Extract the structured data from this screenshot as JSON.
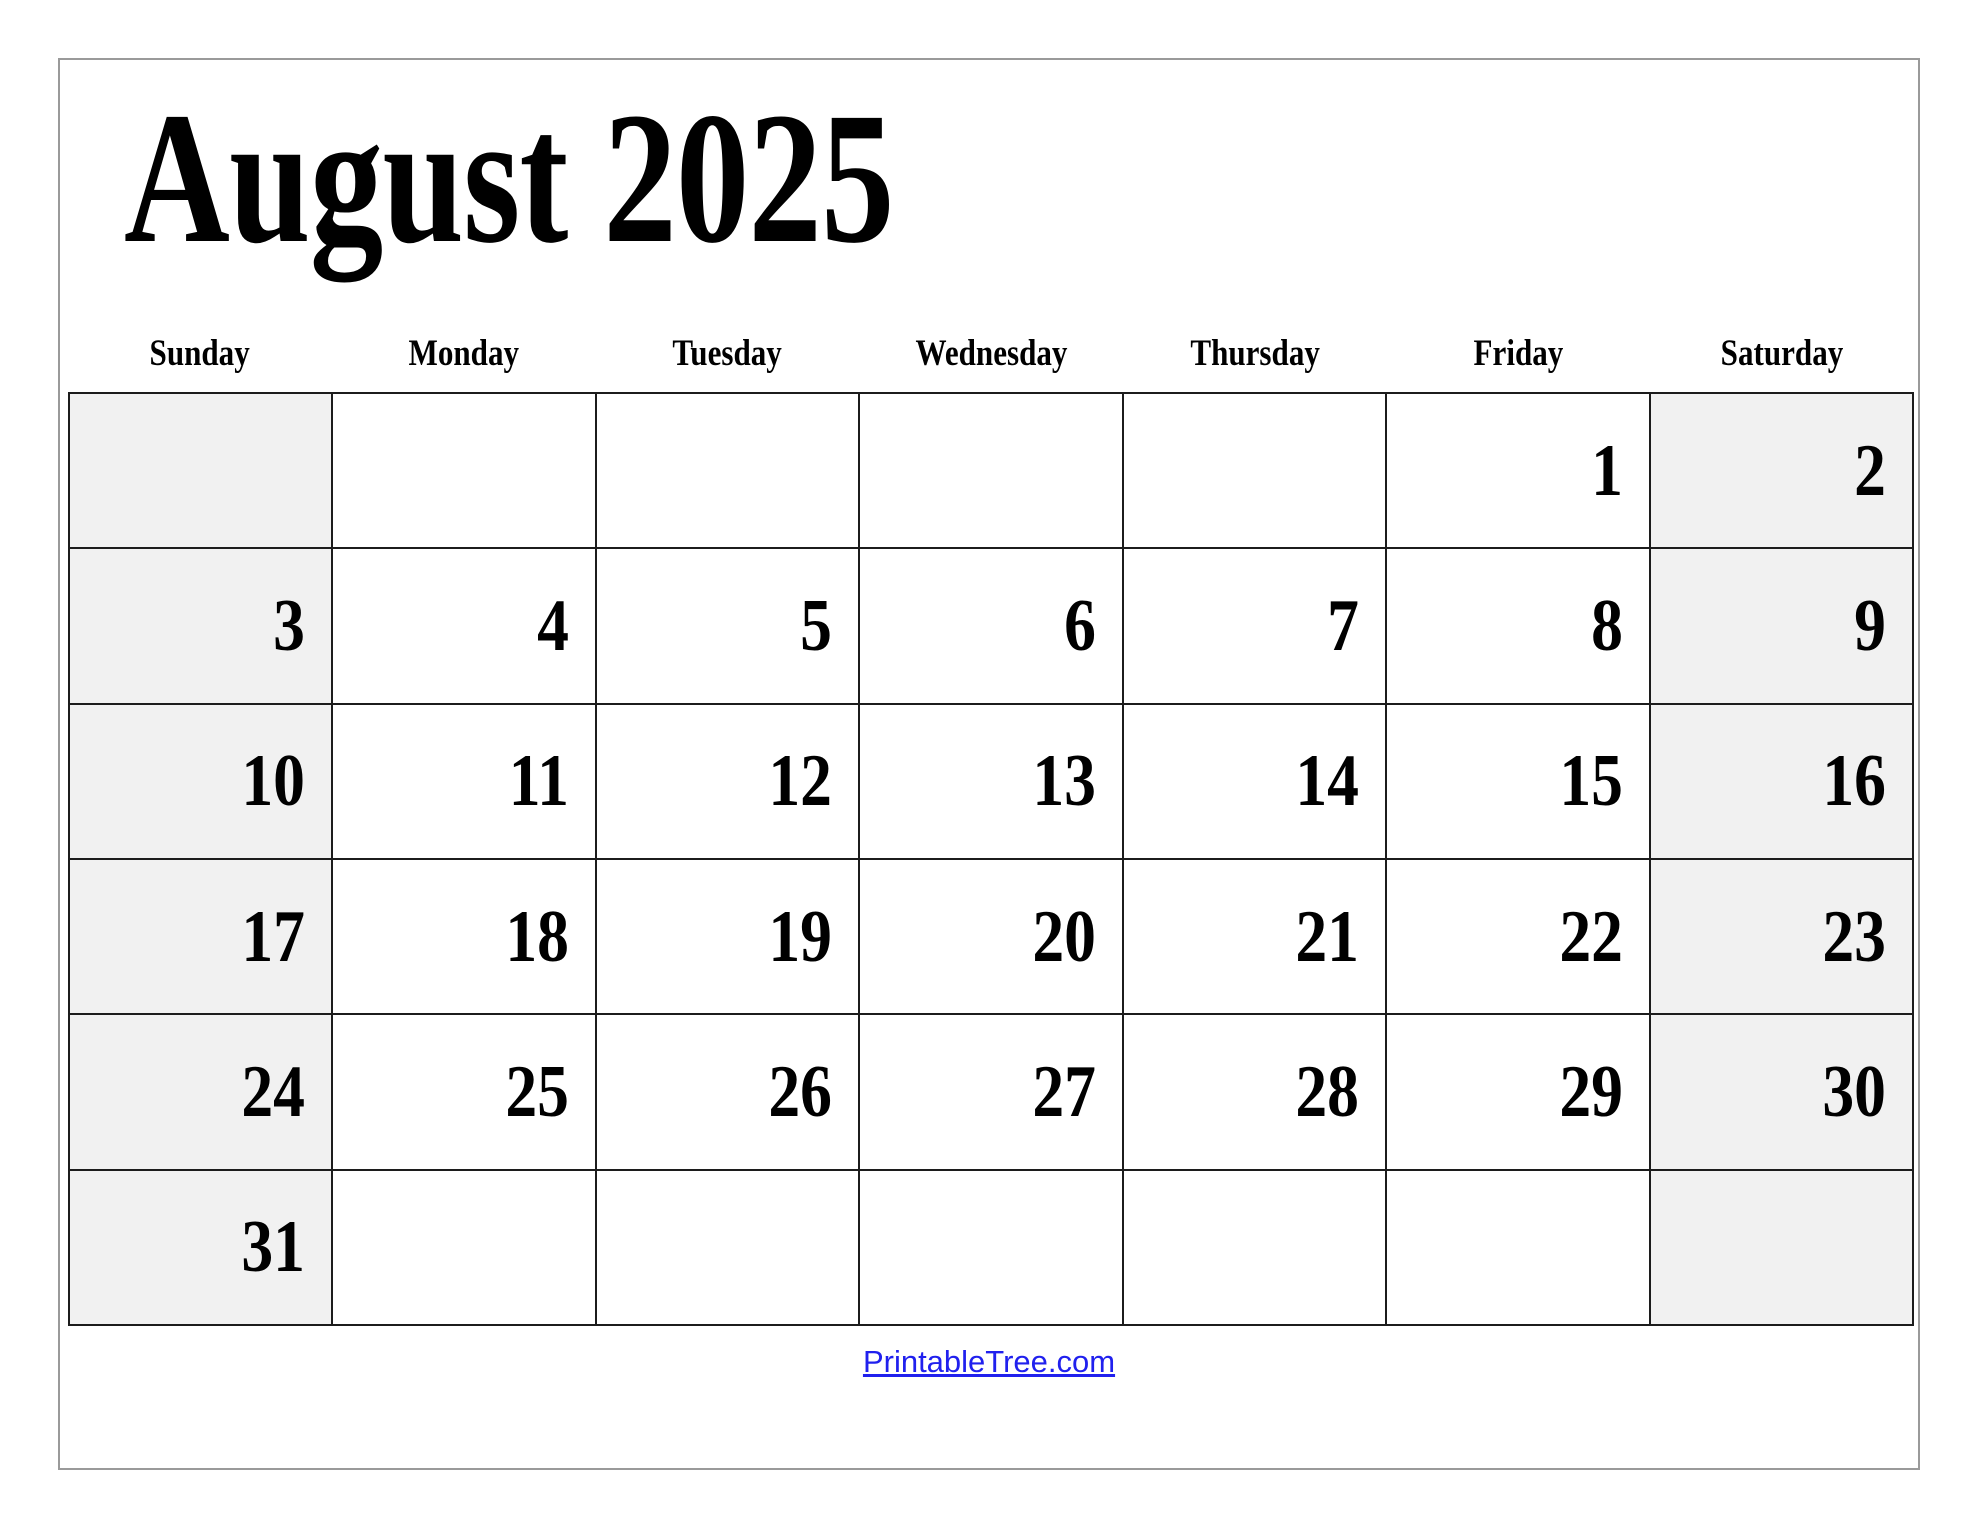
{
  "title": "August 2025",
  "month": "August",
  "year": "2025",
  "weekdays": [
    "Sunday",
    "Monday",
    "Tuesday",
    "Wednesday",
    "Thursday",
    "Friday",
    "Saturday"
  ],
  "weeks": [
    [
      "",
      "",
      "",
      "",
      "",
      "1",
      "2"
    ],
    [
      "3",
      "4",
      "5",
      "6",
      "7",
      "8",
      "9"
    ],
    [
      "10",
      "11",
      "12",
      "13",
      "14",
      "15",
      "16"
    ],
    [
      "17",
      "18",
      "19",
      "20",
      "21",
      "22",
      "23"
    ],
    [
      "24",
      "25",
      "26",
      "27",
      "28",
      "29",
      "30"
    ],
    [
      "31",
      "",
      "",
      "",
      "",
      "",
      ""
    ]
  ],
  "weekend_columns": [
    0,
    6
  ],
  "footer": {
    "link_text": "PrintableTree.com"
  },
  "colors": {
    "text": "#000000",
    "weekend_cell": "#f1f1f1",
    "cell": "#ffffff",
    "grid_line": "#1c1c1c",
    "page_border": "#9a9a9a",
    "link": "#2020ee"
  }
}
